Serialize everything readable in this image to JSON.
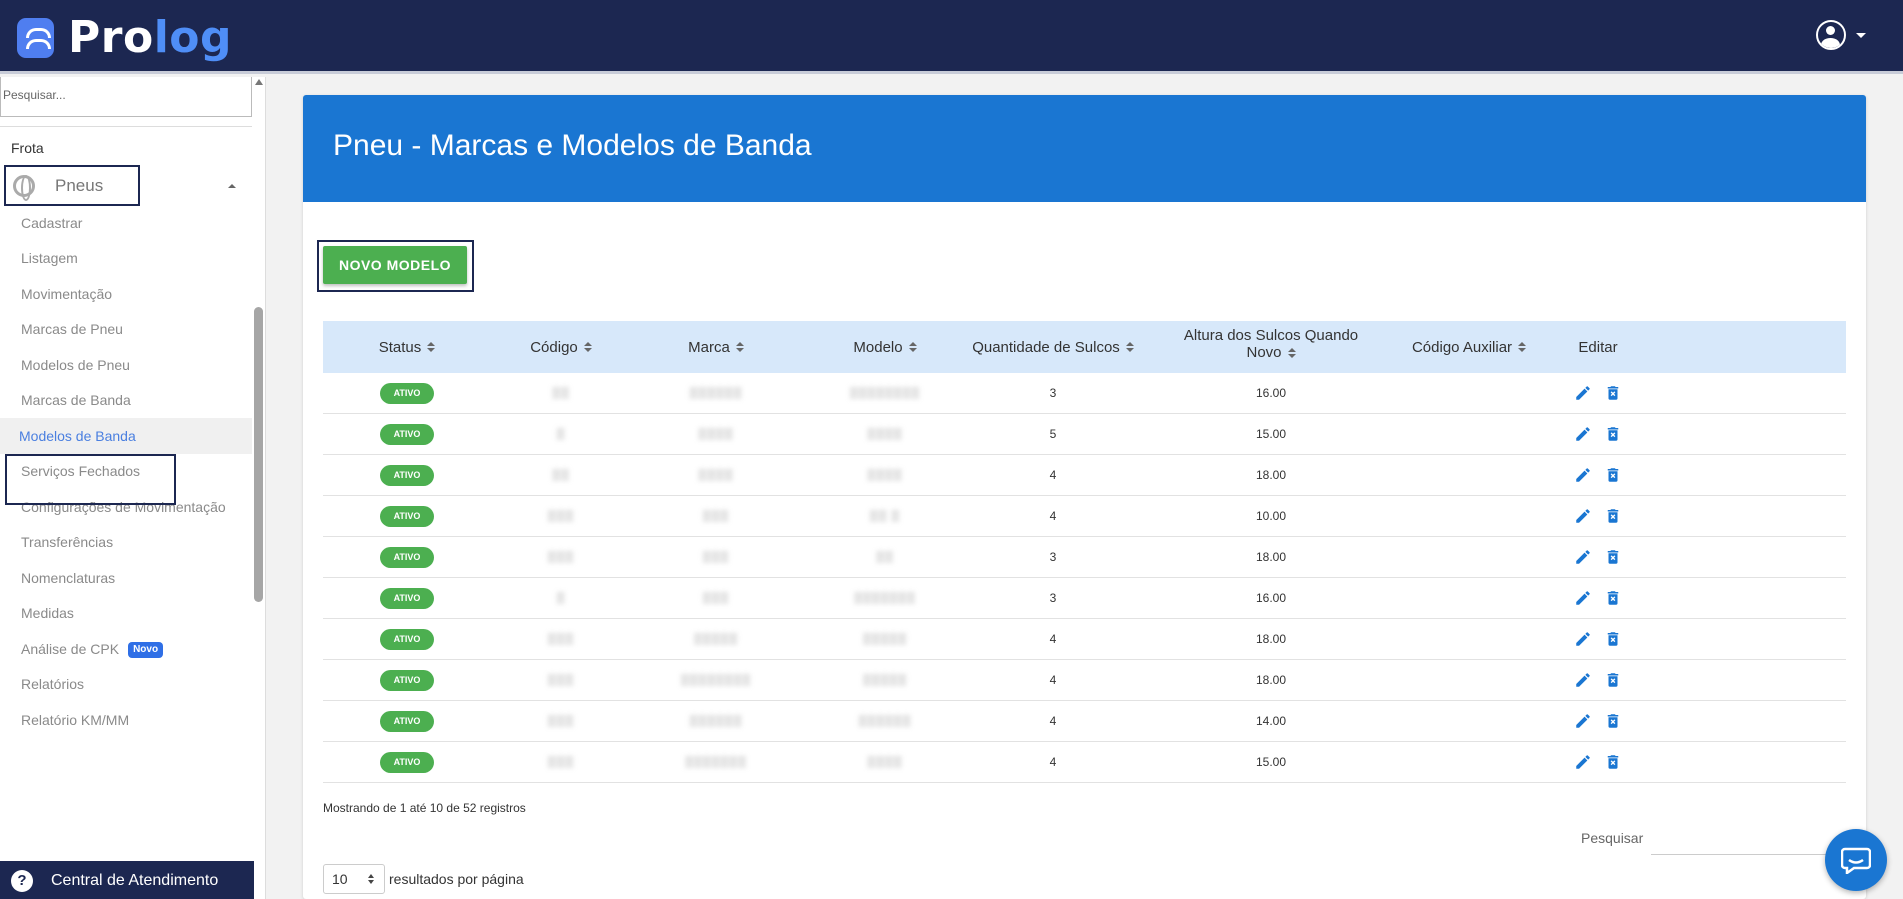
{
  "app": {
    "logo_text_main": "Pro",
    "logo_text_accent": "log"
  },
  "sidebar": {
    "search_placeholder": "Pesquisar...",
    "section": "Frota",
    "group": "Pneus",
    "items": [
      {
        "label": "Cadastrar"
      },
      {
        "label": "Listagem"
      },
      {
        "label": "Movimentação"
      },
      {
        "label": "Marcas de Pneu"
      },
      {
        "label": "Modelos de Pneu"
      },
      {
        "label": "Marcas de Banda"
      },
      {
        "label": "Modelos de Banda",
        "active": true
      },
      {
        "label": "Serviços Fechados"
      },
      {
        "label": "Configurações de Movimentação"
      },
      {
        "label": "Transferências"
      },
      {
        "label": "Nomenclaturas"
      },
      {
        "label": "Medidas"
      },
      {
        "label": "Análise de CPK",
        "badge": "Novo"
      },
      {
        "label": "Relatórios"
      },
      {
        "label": "Relatório KM/MM"
      }
    ],
    "central": "Central de Atendimento"
  },
  "page": {
    "title": "Pneu - Marcas e Modelos de Banda",
    "new_button": "NOVO MODELO"
  },
  "table": {
    "columns": [
      {
        "label": "Status",
        "sortable": true
      },
      {
        "label": "Código",
        "sortable": true
      },
      {
        "label": "Marca",
        "sortable": true
      },
      {
        "label": "Modelo",
        "sortable": true
      },
      {
        "label": "Quantidade de Sulcos",
        "sortable": true
      },
      {
        "label": "Altura dos Sulcos Quando Novo",
        "sortable": true
      },
      {
        "label": "Código Auxiliar",
        "sortable": true
      },
      {
        "label": "Editar",
        "sortable": false
      }
    ],
    "rows": [
      {
        "status": "ATIVO",
        "sulcos": "3",
        "altura": "16.00"
      },
      {
        "status": "ATIVO",
        "sulcos": "5",
        "altura": "15.00"
      },
      {
        "status": "ATIVO",
        "sulcos": "4",
        "altura": "18.00"
      },
      {
        "status": "ATIVO",
        "sulcos": "4",
        "altura": "10.00"
      },
      {
        "status": "ATIVO",
        "sulcos": "3",
        "altura": "18.00"
      },
      {
        "status": "ATIVO",
        "sulcos": "3",
        "altura": "16.00"
      },
      {
        "status": "ATIVO",
        "sulcos": "4",
        "altura": "18.00"
      },
      {
        "status": "ATIVO",
        "sulcos": "4",
        "altura": "18.00"
      },
      {
        "status": "ATIVO",
        "sulcos": "4",
        "altura": "14.00"
      },
      {
        "status": "ATIVO",
        "sulcos": "4",
        "altura": "15.00"
      }
    ],
    "showing": "Mostrando de 1 até 10 de 52 registros",
    "search_label": "Pesquisar",
    "per_page_value": "10",
    "per_page_label": "resultados por página"
  },
  "colors": {
    "topbar": "#1c2751",
    "header": "#1a76d2",
    "active_green": "#4caf50",
    "action_blue": "#1a76d2"
  }
}
